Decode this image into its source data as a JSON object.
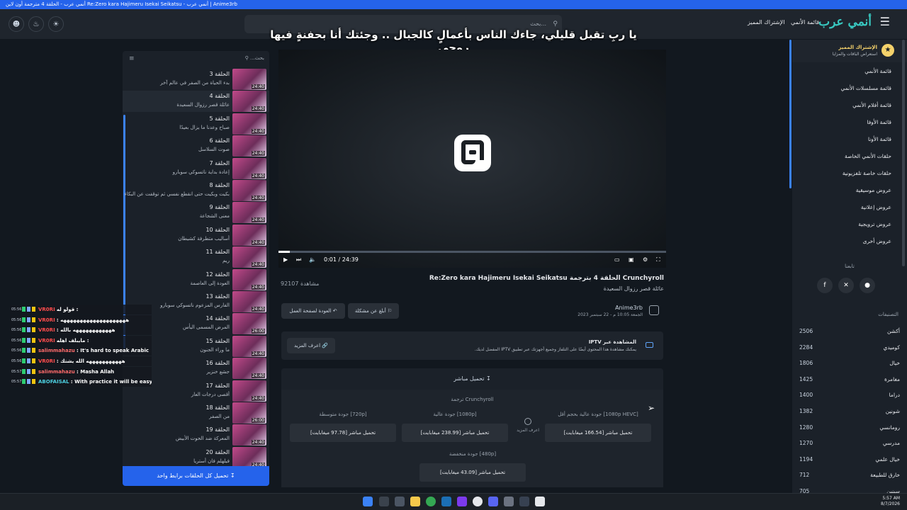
{
  "window": {
    "title": "أنمي عرب - الحلقة 4 مترجمة أون لاين Re:Zero kara Hajimeru Isekai Seikatsu - أنمي عرب | Anime3rb"
  },
  "header": {
    "search_placeholder": "بحث...",
    "nav_links": [
      "قائمة الأنمي",
      "الإشتراك المميز"
    ],
    "logo": "أنمي عرب"
  },
  "overlay_text": "يا ربِ تقبل قليلي، جاءك الناس بأعمالٍ كالجبال .. وجئتك أنا بحفنةٍ فيها روحي",
  "episodes": {
    "search_placeholder": "بحث...",
    "items": [
      {
        "num": "الحلقة 3",
        "name": "بدء الحياة من الصفر في عالم آخر",
        "duration": "24:40"
      },
      {
        "num": "الحلقة 4",
        "name": "عائلة قصر رزوال السعيدة",
        "duration": "24:40"
      },
      {
        "num": "الحلقة 5",
        "name": "صباح وعدنا ما يزال بعيدًا",
        "duration": "24:40"
      },
      {
        "num": "الحلقة 6",
        "name": "صوت السلاسل",
        "duration": "24:40"
      },
      {
        "num": "الحلقة 7",
        "name": "إعادة بداية ناتسوكي سوبارو",
        "duration": "24:40"
      },
      {
        "num": "الحلقة 8",
        "name": "بكيت وبكيت حتى انقطع نفسي ثم توقفت عن البكاء",
        "duration": "24:40"
      },
      {
        "num": "الحلقة 9",
        "name": "معنى الشجاعة",
        "duration": "24:40"
      },
      {
        "num": "الحلقة 10",
        "name": "أساليب متطرفة كشيطان",
        "duration": "24:40"
      },
      {
        "num": "الحلقة 11",
        "name": "ريم",
        "duration": "24:40"
      },
      {
        "num": "الحلقة 12",
        "name": "العودة إلى العاصمة",
        "duration": "24:40"
      },
      {
        "num": "الحلقة 13",
        "name": "الفارس المزعوم ناتسوكي سوبارو",
        "duration": "24:40"
      },
      {
        "num": "الحلقة 14",
        "name": "المرض المسمى اليأس",
        "duration": "26:00"
      },
      {
        "num": "الحلقة 15",
        "name": "ما وراء الجنون",
        "duration": "24:40"
      },
      {
        "num": "الحلقة 16",
        "name": "جشع خنزير",
        "duration": "24:40"
      },
      {
        "num": "الحلقة 17",
        "name": "أقصى درجات العار",
        "duration": "24:40"
      },
      {
        "num": "الحلقة 18",
        "name": "من الصفر",
        "duration": "26:00"
      },
      {
        "num": "الحلقة 19",
        "name": "المعركة ضد الحوت الأبيض",
        "duration": "24:40"
      },
      {
        "num": "الحلقة 20",
        "name": "فيلهلم فان أستريا",
        "duration": "24:40"
      }
    ],
    "download_all": "تحميل كل الحلقات برابط واحد"
  },
  "player": {
    "time": "0:01 / 24:39",
    "progress": 0.03
  },
  "episode": {
    "title": "Re:Zero kara Hajimeru Isekai Seikatsu الحلقة 4 بترجمة Crunchyroll",
    "subtitle": "عائلة قصر رزوال السعيدة",
    "views": "92107 مشاهدة",
    "report_btn": "أبلغ عن مشكلة",
    "back_btn": "العودة لصفحة العمل",
    "uploader": "Anime3rb",
    "date": "الجمعة 10:05 م - 22 سبتمبر 2023"
  },
  "iptv": {
    "title": "المشاهدة عبر IPTV",
    "desc": "يمكنك مشاهدة هذا المحتوى أيضًا على التلفاز وجميع أجهزتك عبر تطبيق IPTV المفضل لديك.",
    "learn_more": "اعرف المزيد"
  },
  "downloads": {
    "header": "تحميل مباشر",
    "source": "ترجمة Crunchyroll",
    "learn_more": "اعرف المزيد",
    "qualities": [
      {
        "label": "جودة عالية بحجم أقل [1080p HEVC]",
        "button": "تحميل مباشر [166.54 ميغابايت]"
      },
      {
        "label": "جودة عالية [1080p]",
        "button": "تحميل مباشر [238.99 ميغابايت]"
      },
      {
        "label": "جودة متوسطة [720p]",
        "button": "تحميل مباشر [97.78 ميغابايت]"
      },
      {
        "label": "جودة منخفضة [480p]",
        "button": "تحميل مباشر [43.09 ميغابايت]"
      }
    ]
  },
  "sidebar": {
    "premium_title": "الإشتراك المميز",
    "premium_sub": "استعراض الباقات والمزايا",
    "menu": [
      "قائمة الأنمي",
      "قائمة مسلسلات الأنمي",
      "قائمة أفلام الأنمي",
      "قائمة الأوفا",
      "قائمة الأونا",
      "حلقات الأنمي الخاصة",
      "حلقات خاصة تلفزيونية",
      "عروض موسيقية",
      "عروض إعلانية",
      "عروض ترويجية",
      "عروض أخرى"
    ],
    "follow": "تابعنا",
    "categories_title": "التصنيفات",
    "categories": [
      {
        "name": "أكشن",
        "count": "2506"
      },
      {
        "name": "كوميدي",
        "count": "2284"
      },
      {
        "name": "خيال",
        "count": "1806"
      },
      {
        "name": "مغامرة",
        "count": "1425"
      },
      {
        "name": "دراما",
        "count": "1400"
      },
      {
        "name": "شونين",
        "count": "1382"
      },
      {
        "name": "رومانسي",
        "count": "1280"
      },
      {
        "name": "مدرسي",
        "count": "1270"
      },
      {
        "name": "خيال علمي",
        "count": "1194"
      },
      {
        "name": "خارق للطبيعة",
        "count": "712"
      },
      {
        "name": "سينين",
        "count": "705"
      }
    ]
  },
  "chat": [
    {
      "time": "05:56",
      "user": "VR0RI",
      "ucolor": "#ff4d4d",
      "text": "قولو له :"
    },
    {
      "time": "05:56",
      "user": "VR0RI",
      "ucolor": "#ff4d4d",
      "text": ": ههههههههههههههههههههه"
    },
    {
      "time": "05:56",
      "user": "VR0RI",
      "ucolor": "#ff4d4d",
      "text": ": ههههههههههههه بالله"
    },
    {
      "time": "05:56",
      "user": "VR0RI",
      "ucolor": "#ff4d4d",
      "text": "مايبلف اهله :"
    },
    {
      "time": "05:56",
      "user": "salimmahazu",
      "ucolor": "#ff6b6b",
      "text": ": It's hard to speak Arabic"
    },
    {
      "time": "05:56",
      "user": "VR0RI",
      "ucolor": "#ff4d4d",
      "text": ": هههههههههههه الله يشتك"
    },
    {
      "time": "05:57",
      "user": "salimmahazu",
      "ucolor": "#ff6b6b",
      "text": ": Masha Allah"
    },
    {
      "time": "05:57",
      "user": "ABOFAISAL",
      "ucolor": "#4dd0e1",
      "text": ": With practice it will be easy"
    }
  ],
  "taskbar": {
    "time": "5:57 AM",
    "date": "8/7/2026"
  }
}
